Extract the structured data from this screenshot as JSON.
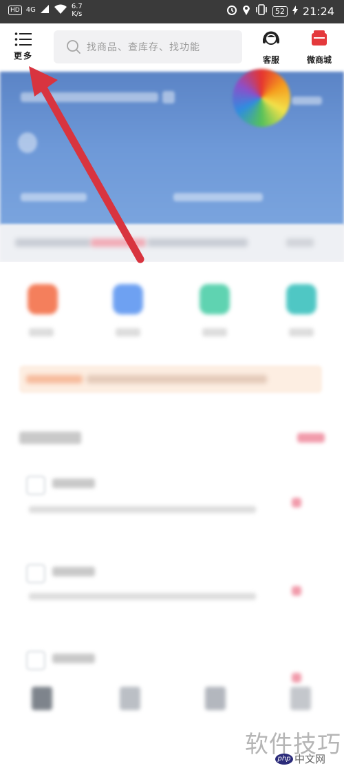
{
  "status_bar": {
    "hd": "HD",
    "network": "4G",
    "speed_value": "6.7",
    "speed_unit": "K/s",
    "battery": "52",
    "time": "21:24"
  },
  "header": {
    "more_label": "更多",
    "search_placeholder": "找商品、查库存、找功能",
    "service_label": "客服",
    "store_label": "微商城"
  },
  "watermark": {
    "main": "软件技巧",
    "php_badge": "php",
    "site": "中文网"
  },
  "colors": {
    "arrow": "#d8343f",
    "banner": "#6e99d8",
    "store_icon": "#e4393c"
  }
}
